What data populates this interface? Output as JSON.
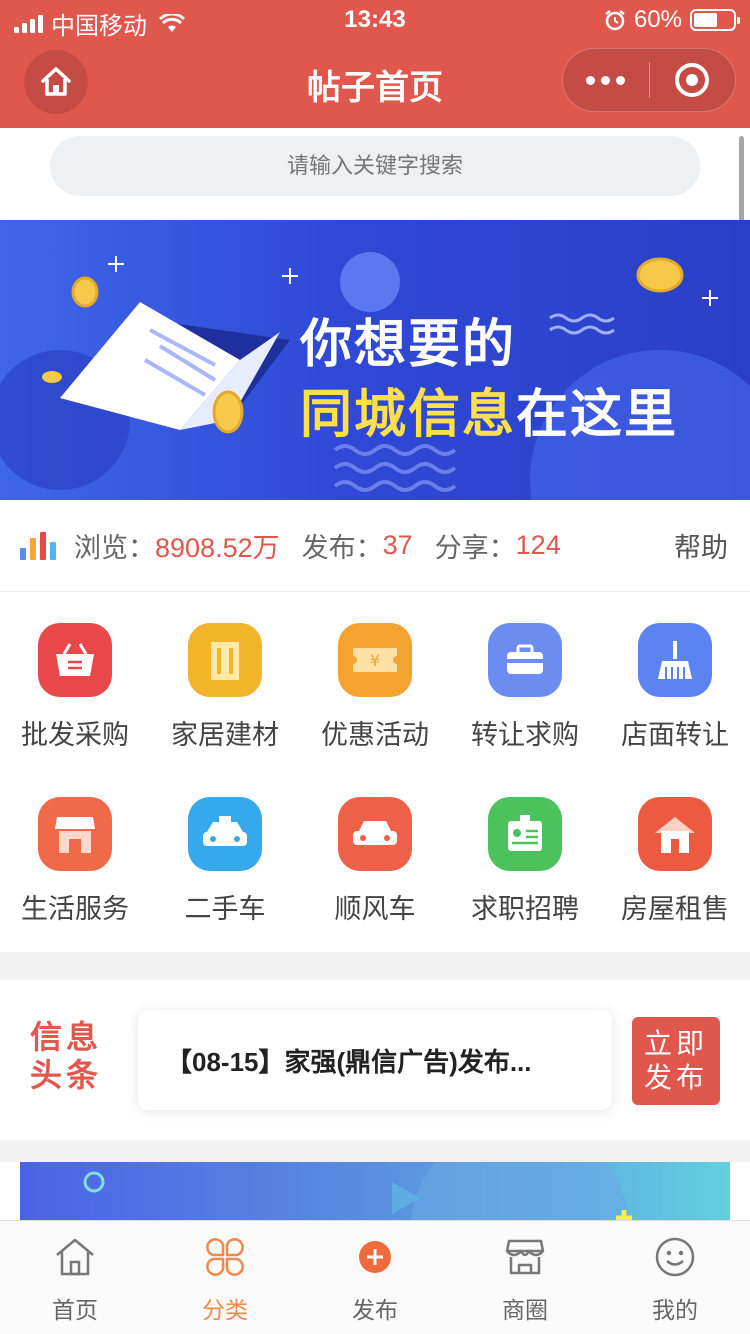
{
  "status_bar": {
    "carrier": "中国移动",
    "time": "13:43",
    "battery": "60%",
    "battery_level": 0.6
  },
  "nav": {
    "title": "帖子首页"
  },
  "search": {
    "placeholder": "请输入关键字搜索"
  },
  "banner": {
    "line1": "你想要的",
    "line2_highlight": "同城信息",
    "line2_rest": "在这里"
  },
  "stats": {
    "views_label": "浏览：",
    "views_value": "8908.52万",
    "posts_label": "发布：",
    "posts_value": "37",
    "shares_label": "分享：",
    "shares_value": "124",
    "help": "帮助"
  },
  "categories": [
    {
      "label": "批发采购",
      "icon": "basket-icon",
      "color": "#e9484b"
    },
    {
      "label": "家居建材",
      "icon": "building-icon",
      "color": "#f3b32a"
    },
    {
      "label": "优惠活动",
      "icon": "coupon-icon",
      "color": "#f4a331"
    },
    {
      "label": "转让求购",
      "icon": "toolbox-icon",
      "color": "#6d8cf2"
    },
    {
      "label": "店面转让",
      "icon": "broom-icon",
      "color": "#5b83f1"
    },
    {
      "label": "生活服务",
      "icon": "shop-icon",
      "color": "#f06a4a"
    },
    {
      "label": "二手车",
      "icon": "taxi-icon",
      "color": "#35a9ec"
    },
    {
      "label": "顺风车",
      "icon": "car-icon",
      "color": "#ef6049"
    },
    {
      "label": "求职招聘",
      "icon": "badge-icon",
      "color": "#4cc25c"
    },
    {
      "label": "房屋租售",
      "icon": "house-icon",
      "color": "#ec5a3f"
    }
  ],
  "headline": {
    "tag_line1": "信息",
    "tag_line2": "头条",
    "text": "【08-15】家强(鼎信广告)发布...",
    "post_line1": "立即",
    "post_line2": "发布"
  },
  "tabbar": [
    {
      "label": "首页",
      "icon": "home-icon",
      "active": false
    },
    {
      "label": "分类",
      "icon": "category-icon",
      "active": true
    },
    {
      "label": "发布",
      "icon": "plus-icon",
      "active": false
    },
    {
      "label": "商圈",
      "icon": "store-icon",
      "active": false
    },
    {
      "label": "我的",
      "icon": "smile-icon",
      "active": false
    }
  ],
  "colors": {
    "brand": "#e0574e",
    "active_tab": "#f08a4b",
    "highlight_yellow": "#ffe04a",
    "banner_blue": "#2f49d6"
  }
}
